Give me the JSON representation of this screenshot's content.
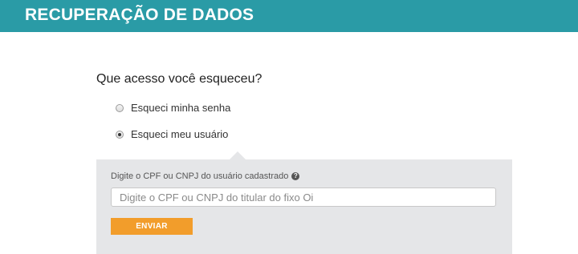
{
  "header": {
    "title": "RECUPERAÇÃO DE DADOS"
  },
  "form": {
    "question": "Que acesso você esqueceu?",
    "options": [
      {
        "label": "Esqueci minha senha",
        "selected": false
      },
      {
        "label": "Esqueci meu usuário",
        "selected": true
      }
    ],
    "panel": {
      "field_label": "Digite o CPF ou CNPJ do usuário cadastrado",
      "help_icon": "question-circle-icon",
      "input_value": "",
      "input_placeholder": "Digite o CPF ou CNPJ do titular do fixo Oi",
      "submit_label": "ENVIAR"
    }
  },
  "colors": {
    "header_bg": "#2a9ba6",
    "panel_bg": "#e5e6e8",
    "button_bg": "#f29d2b"
  }
}
